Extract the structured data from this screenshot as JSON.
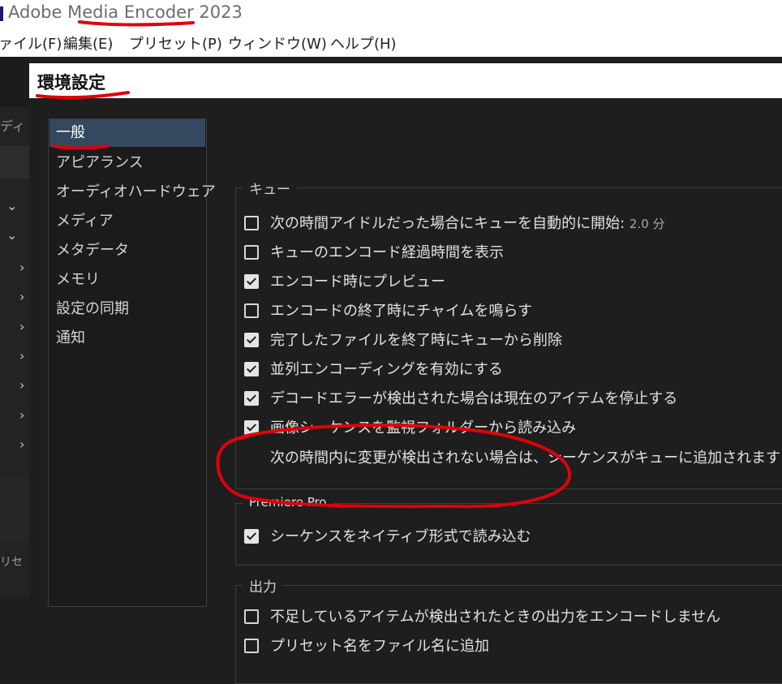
{
  "app": {
    "title": "Adobe Media Encoder 2023"
  },
  "menubar": {
    "items": [
      "ァイル(F)",
      "編集(E)",
      "プリセット(P)",
      "ウィンドウ(W)",
      "ヘルプ(H)"
    ]
  },
  "background": {
    "side_text_1": "ディ",
    "side_text_2": "リセ"
  },
  "dialog": {
    "title": "環境設定",
    "sidebar": {
      "items": [
        "一般",
        "アピアランス",
        "オーディオハードウェア",
        "メディア",
        "メタデータ",
        "メモリ",
        "設定の同期",
        "通知"
      ],
      "selected": "一般"
    },
    "queue_group": {
      "legend": "キュー",
      "options": [
        {
          "label": "次の時間アイドルだった場合にキューを自動的に開始:",
          "value": "2.0 分",
          "checked": false
        },
        {
          "label": "キューのエンコード経過時間を表示",
          "checked": false
        },
        {
          "label": "エンコード時にプレビュー",
          "checked": true
        },
        {
          "label": "エンコードの終了時にチャイムを鳴らす",
          "checked": false
        },
        {
          "label": "完了したファイルを終了時にキューから削除",
          "checked": true
        },
        {
          "label": "並列エンコーディングを有効にする",
          "checked": true
        },
        {
          "label": "デコードエラーが検出された場合は現在のアイテムを停止する",
          "checked": true
        },
        {
          "label": "画像シーケンスを監視フォルダーから読み込み",
          "checked": true
        }
      ],
      "note": "次の時間内に変更が検出されない場合は、シーケンスがキューに追加されます："
    },
    "premiere_group": {
      "legend": "Premiere Pro",
      "options": [
        {
          "label": "シーケンスをネイティブ形式で読み込む",
          "checked": true
        }
      ]
    },
    "output_group": {
      "legend": "出力",
      "options": [
        {
          "label": "不足しているアイテムが検出されたときの出力をエンコードしません",
          "checked": false
        },
        {
          "label": "プリセット名をファイル名に追加",
          "checked": false
        }
      ]
    }
  },
  "annotation_color": "#e0000b"
}
